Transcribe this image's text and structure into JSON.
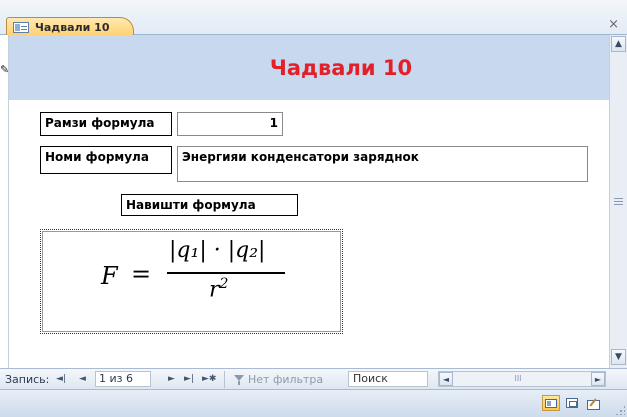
{
  "window": {
    "tab_label": "Чадвали 10",
    "close_glyph": "×",
    "icons": [
      "table-form-icon",
      "close-icon",
      "edit-record-pencil-icon"
    ]
  },
  "form": {
    "header_title": "Чадвали 10",
    "header_color": "#c8d9ef",
    "title_color": "#e31f2a",
    "fields": {
      "formula_code_label": "Рамзи формула",
      "formula_code_value": "1",
      "formula_name_label": "Номи формула",
      "formula_name_value": "Энергияи конденсатори заряднок",
      "formula_write_label": "Навишти формула"
    },
    "formula": {
      "lhs": "F",
      "eq": "=",
      "numerator": "|q₁| · |q₂|",
      "denominator_base": "r",
      "denominator_exp": "2"
    }
  },
  "navigation": {
    "record_label": "Запись:",
    "first": "◄|",
    "prev": "◄",
    "counter": "1 из 6",
    "next": "►",
    "last": "►|",
    "new": "►✱",
    "filter_label": "Нет фильтра",
    "search_placeholder": "Поиск",
    "hscroll_left": "◄",
    "hscroll_right": "►",
    "hscroll_grip": "III"
  },
  "scrollbar": {
    "up": "▲",
    "down": "▼"
  },
  "statusbar": {
    "views": [
      "form-view-icon",
      "layout-view-icon",
      "design-view-icon"
    ]
  }
}
